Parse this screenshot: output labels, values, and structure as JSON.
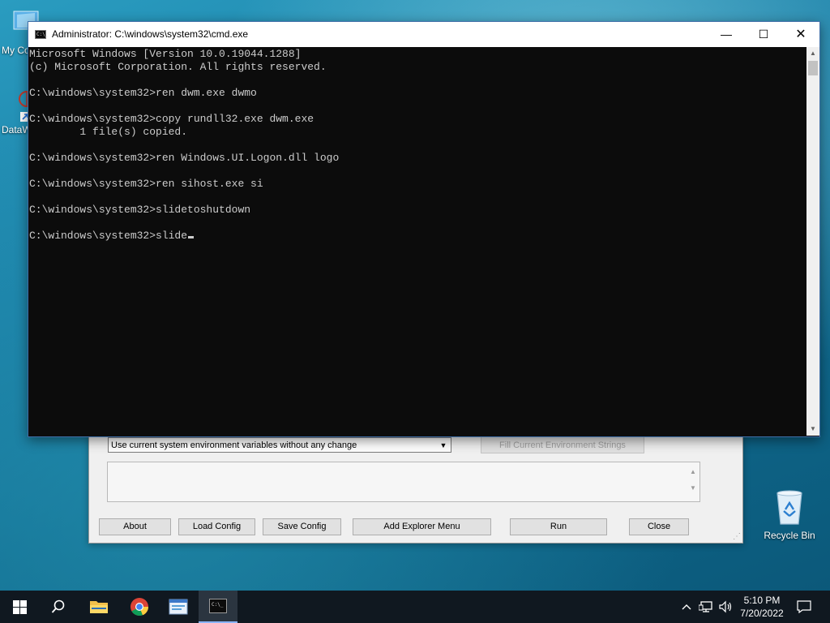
{
  "desktop": {
    "icons": [
      {
        "label": "My Co"
      },
      {
        "label": "DataW"
      },
      {
        "label": "Recycle Bin"
      }
    ]
  },
  "background_window": {
    "env_select_value": "Use current system environment variables without any change",
    "fill_button": "Fill Current Environment Strings",
    "buttons": {
      "about": "About",
      "load_config": "Load Config",
      "save_config": "Save Config",
      "add_explorer_menu": "Add Explorer Menu",
      "run": "Run",
      "close": "Close"
    }
  },
  "cmd_window": {
    "title": "Administrator: C:\\windows\\system32\\cmd.exe",
    "lines": [
      "Microsoft Windows [Version 10.0.19044.1288]",
      "(c) Microsoft Corporation. All rights reserved.",
      "",
      "C:\\windows\\system32>ren dwm.exe dwmo",
      "",
      "C:\\windows\\system32>copy rundll32.exe dwm.exe",
      "        1 file(s) copied.",
      "",
      "C:\\windows\\system32>ren Windows.UI.Logon.dll logo",
      "",
      "C:\\windows\\system32>ren sihost.exe si",
      "",
      "C:\\windows\\system32>slidetoshutdown",
      "",
      "C:\\windows\\system32>slide"
    ]
  },
  "taskbar": {
    "time": "5:10 PM",
    "date": "7/20/2022"
  },
  "icons": {
    "start": "windows-logo-icon",
    "search": "search-icon",
    "explorer": "folder-icon",
    "chrome": "chrome-icon",
    "app": "app-window-icon",
    "cmd": "terminal-icon",
    "tray_chevron": "chevron-up-icon",
    "network": "network-icon",
    "volume": "volume-icon",
    "notifications": "notification-icon"
  }
}
